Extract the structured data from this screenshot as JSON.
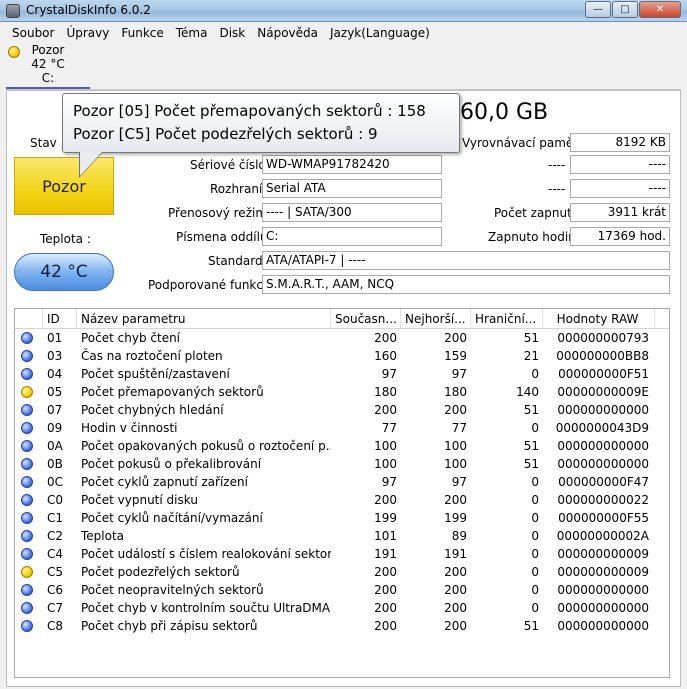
{
  "window": {
    "title": "CrystalDiskInfo 6.0.2"
  },
  "menu": [
    "Soubor",
    "Úpravy",
    "Funkce",
    "Téma",
    "Disk",
    "Nápověda",
    "Jazyk(Language)"
  ],
  "disk_tab": {
    "status": "Pozor",
    "temp": "42 °C",
    "drive": "C:"
  },
  "tooltip": {
    "line1": "Pozor [05] Počet přemapovaných sektorů : 158",
    "line2": "Pozor [C5] Počet podezřelých sektorů : 9"
  },
  "header": {
    "size_text": "60,0 GB"
  },
  "health": {
    "label": "Stav",
    "status": "Pozor"
  },
  "temperature": {
    "label": "Teplota :",
    "value": "42 °C"
  },
  "info": {
    "serial_label": "Sériové číslo",
    "serial": "WD-WMAP91782420",
    "interface_label": "Rozhraní",
    "interface": "Serial ATA",
    "transfer_label": "Přenosový režim",
    "transfer": "---- | SATA/300",
    "drive_label": "Písmena oddílů",
    "drive": "C:",
    "standard_label": "Standard",
    "standard": "ATA/ATAPI-7 | ----",
    "features_label": "Podporované funkce",
    "features": "S.M.A.R.T., AAM, NCQ"
  },
  "right_info": {
    "buffer_label": "Vyrovnávací paměť",
    "buffer": "8192 KB",
    "blank1_label": "----",
    "blank1": "----",
    "blank2_label": "----",
    "blank2": "----",
    "power_count_label": "Počet zapnutí",
    "power_count": "3911 krát",
    "power_hours_label": "Zapnuto hodin",
    "power_hours": "17369 hod."
  },
  "table": {
    "columns": [
      "ID",
      "Název parametru",
      "Současn...",
      "Nejhorší...",
      "Hraniční...",
      "Hodnoty RAW"
    ],
    "rows": [
      {
        "status": "ok",
        "id": "01",
        "name": "Počet chyb čtení",
        "current": "200",
        "worst": "200",
        "threshold": "51",
        "raw": "000000000793"
      },
      {
        "status": "ok",
        "id": "03",
        "name": "Čas na roztočení ploten",
        "current": "160",
        "worst": "159",
        "threshold": "21",
        "raw": "000000000BB8"
      },
      {
        "status": "ok",
        "id": "04",
        "name": "Počet spuštění/zastavení",
        "current": "97",
        "worst": "97",
        "threshold": "0",
        "raw": "000000000F51"
      },
      {
        "status": "warn",
        "id": "05",
        "name": "Počet přemapovaných sektorů",
        "current": "180",
        "worst": "180",
        "threshold": "140",
        "raw": "00000000009E"
      },
      {
        "status": "ok",
        "id": "07",
        "name": "Počet chybných hledání",
        "current": "200",
        "worst": "200",
        "threshold": "51",
        "raw": "000000000000"
      },
      {
        "status": "ok",
        "id": "09",
        "name": "Hodin v činnosti",
        "current": "77",
        "worst": "77",
        "threshold": "0",
        "raw": "0000000043D9"
      },
      {
        "status": "ok",
        "id": "0A",
        "name": "Počet opakovaných pokusů o roztočení p...",
        "current": "100",
        "worst": "100",
        "threshold": "51",
        "raw": "000000000000"
      },
      {
        "status": "ok",
        "id": "0B",
        "name": "Počet pokusů o překalibrování",
        "current": "100",
        "worst": "100",
        "threshold": "51",
        "raw": "000000000000"
      },
      {
        "status": "ok",
        "id": "0C",
        "name": "Počet cyklů zapnutí zařízení",
        "current": "97",
        "worst": "97",
        "threshold": "0",
        "raw": "000000000F47"
      },
      {
        "status": "ok",
        "id": "C0",
        "name": "Počet vypnutí disku",
        "current": "200",
        "worst": "200",
        "threshold": "0",
        "raw": "000000000022"
      },
      {
        "status": "ok",
        "id": "C1",
        "name": "Počet cyklů načítání/vymazání",
        "current": "199",
        "worst": "199",
        "threshold": "0",
        "raw": "000000000F55"
      },
      {
        "status": "ok",
        "id": "C2",
        "name": "Teplota",
        "current": "101",
        "worst": "89",
        "threshold": "0",
        "raw": "00000000002A"
      },
      {
        "status": "ok",
        "id": "C4",
        "name": "Počet událostí s číslem realokování sektorů",
        "current": "191",
        "worst": "191",
        "threshold": "0",
        "raw": "000000000009"
      },
      {
        "status": "warn",
        "id": "C5",
        "name": "Počet podezřelých sektorů",
        "current": "200",
        "worst": "200",
        "threshold": "0",
        "raw": "000000000009"
      },
      {
        "status": "ok",
        "id": "C6",
        "name": "Počet neopravitelných sektorů",
        "current": "200",
        "worst": "200",
        "threshold": "0",
        "raw": "000000000000"
      },
      {
        "status": "ok",
        "id": "C7",
        "name": "Počet chyb v kontrolním součtu UltraDMA",
        "current": "200",
        "worst": "200",
        "threshold": "0",
        "raw": "000000000000"
      },
      {
        "status": "ok",
        "id": "C8",
        "name": "Počet chyb při zápisu sektorů",
        "current": "200",
        "worst": "200",
        "threshold": "51",
        "raw": "000000000000"
      }
    ]
  }
}
